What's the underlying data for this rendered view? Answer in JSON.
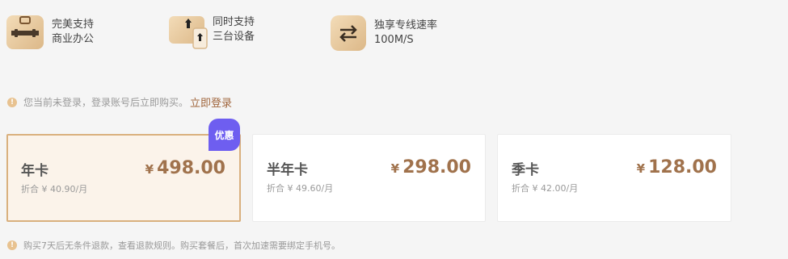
{
  "features": [
    {
      "icon": "briefcase-icon",
      "line1": "完美支持",
      "line2": "商业办公"
    },
    {
      "icon": "multi-device-icon",
      "line1": "同时支持",
      "line2": "三台设备"
    },
    {
      "icon": "swap-arrows-icon",
      "line1": "独享专线速率",
      "line2": "100M/S"
    }
  ],
  "notice": {
    "text": "您当前未登录，登录账号后立即购买。",
    "link": "立即登录"
  },
  "badge": "优惠",
  "plans": [
    {
      "name": "年卡",
      "currency": "¥",
      "price": "498.00",
      "monthly": "折合 ¥ 40.90/月",
      "selected": true
    },
    {
      "name": "半年卡",
      "currency": "¥",
      "price": "298.00",
      "monthly": "折合 ¥ 49.60/月",
      "selected": false
    },
    {
      "name": "季卡",
      "currency": "¥",
      "price": "128.00",
      "monthly": "折合 ¥ 42.00/月",
      "selected": false
    }
  ],
  "footnote": "购买7天后无条件退款，查看退款规则。购买套餐后，首次加速需要绑定手机号。",
  "colors": {
    "accent": "#a0653c",
    "price": "#a0724c",
    "badge": "#6e5ef0",
    "selected_border": "#d9b07e",
    "selected_bg": "#fbf3ea"
  }
}
